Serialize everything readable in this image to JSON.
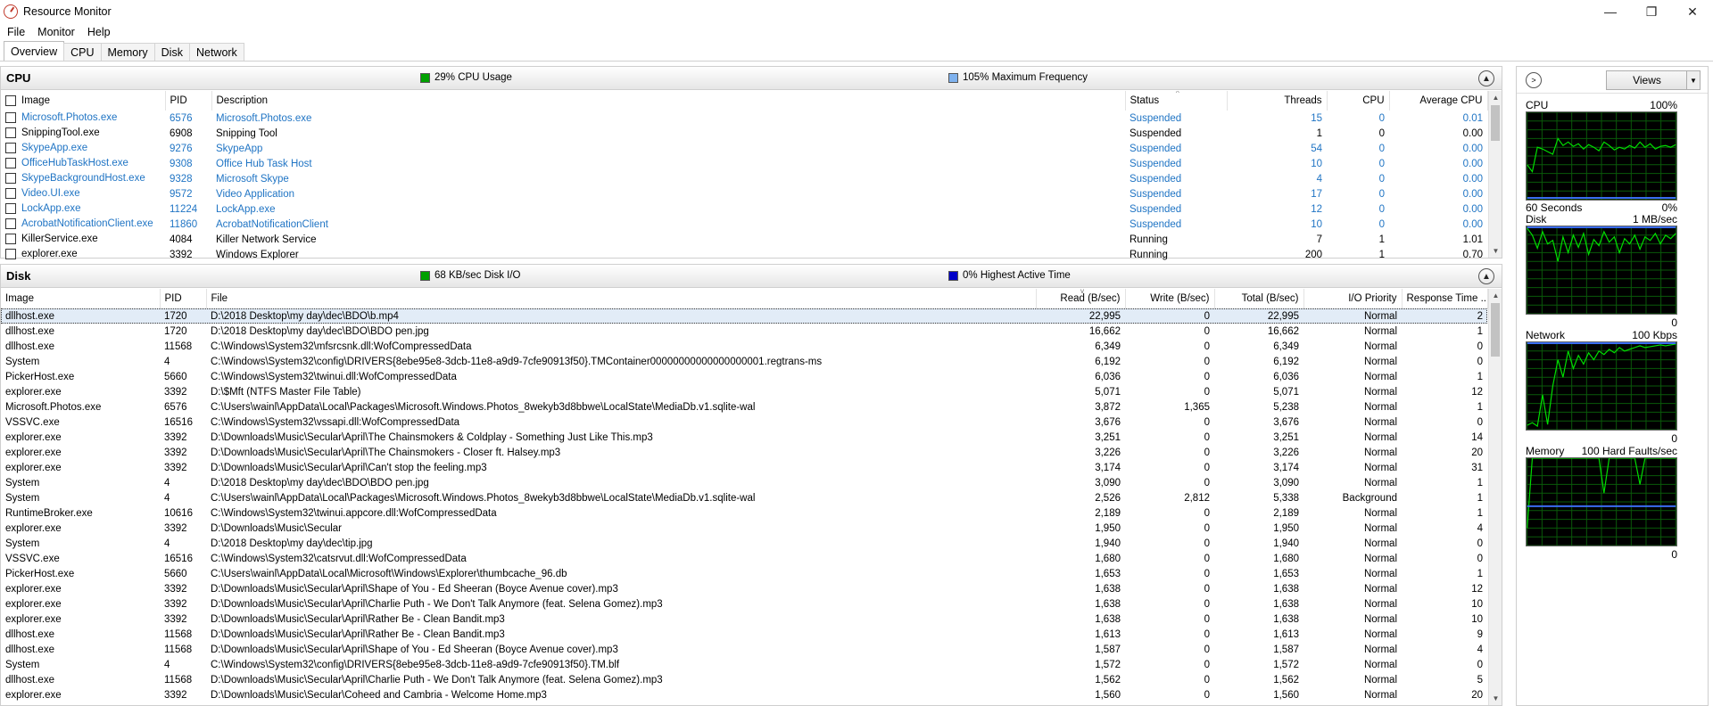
{
  "window": {
    "title": "Resource Monitor",
    "min": "—",
    "max": "❐",
    "close": "✕"
  },
  "menu": [
    {
      "label": "File"
    },
    {
      "label": "Monitor"
    },
    {
      "label": "Help"
    }
  ],
  "tabs": [
    {
      "label": "Overview",
      "active": true
    },
    {
      "label": "CPU"
    },
    {
      "label": "Memory"
    },
    {
      "label": "Disk"
    },
    {
      "label": "Network"
    }
  ],
  "cpu": {
    "title": "CPU",
    "usage_label": "29% CPU Usage",
    "usage_color": "#00a000",
    "freq_label": "105% Maximum Frequency",
    "freq_color": "#7fb2ee",
    "columns": [
      "Image",
      "PID",
      "Description",
      "Status",
      "Threads",
      "CPU",
      "Average CPU"
    ],
    "rows": [
      {
        "image": "Microsoft.Photos.exe",
        "pid": "6576",
        "desc": "Microsoft.Photos.exe",
        "status": "Suspended",
        "threads": "15",
        "cpu": "0",
        "avg": "0.01",
        "blue": true
      },
      {
        "image": "SnippingTool.exe",
        "pid": "6908",
        "desc": "Snipping Tool",
        "status": "Suspended",
        "threads": "1",
        "cpu": "0",
        "avg": "0.00",
        "blue": false
      },
      {
        "image": "SkypeApp.exe",
        "pid": "9276",
        "desc": "SkypeApp",
        "status": "Suspended",
        "threads": "54",
        "cpu": "0",
        "avg": "0.00",
        "blue": true
      },
      {
        "image": "OfficeHubTaskHost.exe",
        "pid": "9308",
        "desc": "Office Hub Task Host",
        "status": "Suspended",
        "threads": "10",
        "cpu": "0",
        "avg": "0.00",
        "blue": true
      },
      {
        "image": "SkypeBackgroundHost.exe",
        "pid": "9328",
        "desc": "Microsoft Skype",
        "status": "Suspended",
        "threads": "4",
        "cpu": "0",
        "avg": "0.00",
        "blue": true
      },
      {
        "image": "Video.UI.exe",
        "pid": "9572",
        "desc": "Video Application",
        "status": "Suspended",
        "threads": "17",
        "cpu": "0",
        "avg": "0.00",
        "blue": true
      },
      {
        "image": "LockApp.exe",
        "pid": "11224",
        "desc": "LockApp.exe",
        "status": "Suspended",
        "threads": "12",
        "cpu": "0",
        "avg": "0.00",
        "blue": true
      },
      {
        "image": "AcrobatNotificationClient.exe",
        "pid": "11860",
        "desc": "AcrobatNotificationClient",
        "status": "Suspended",
        "threads": "10",
        "cpu": "0",
        "avg": "0.00",
        "blue": true
      },
      {
        "image": "KillerService.exe",
        "pid": "4084",
        "desc": "Killer Network Service",
        "status": "Running",
        "threads": "7",
        "cpu": "1",
        "avg": "1.01",
        "blue": false
      },
      {
        "image": "explorer.exe",
        "pid": "3392",
        "desc": "Windows Explorer",
        "status": "Running",
        "threads": "200",
        "cpu": "1",
        "avg": "0.70",
        "blue": false
      }
    ]
  },
  "disk": {
    "title": "Disk",
    "io_label": "68 KB/sec Disk I/O",
    "io_color": "#00a000",
    "active_label": "0% Highest Active Time",
    "active_color": "#0000c8",
    "columns": [
      "Image",
      "PID",
      "File",
      "Read (B/sec)",
      "Write (B/sec)",
      "Total (B/sec)",
      "I/O Priority",
      "Response Time ..."
    ],
    "rows": [
      {
        "image": "dllhost.exe",
        "pid": "1720",
        "file": "D:\\2018 Desktop\\my day\\dec\\BDO\\b.mp4",
        "read": "22,995",
        "write": "0",
        "total": "22,995",
        "prio": "Normal",
        "resp": "2",
        "sel": true
      },
      {
        "image": "dllhost.exe",
        "pid": "1720",
        "file": "D:\\2018 Desktop\\my day\\dec\\BDO\\BDO pen.jpg",
        "read": "16,662",
        "write": "0",
        "total": "16,662",
        "prio": "Normal",
        "resp": "1"
      },
      {
        "image": "dllhost.exe",
        "pid": "11568",
        "file": "C:\\Windows\\System32\\mfsrcsnk.dll:WofCompressedData",
        "read": "6,349",
        "write": "0",
        "total": "6,349",
        "prio": "Normal",
        "resp": "0"
      },
      {
        "image": "System",
        "pid": "4",
        "file": "C:\\Windows\\System32\\config\\DRIVERS{8ebe95e8-3dcb-11e8-a9d9-7cfe90913f50}.TMContainer00000000000000000001.regtrans-ms",
        "read": "6,192",
        "write": "0",
        "total": "6,192",
        "prio": "Normal",
        "resp": "0"
      },
      {
        "image": "PickerHost.exe",
        "pid": "5660",
        "file": "C:\\Windows\\System32\\twinui.dll:WofCompressedData",
        "read": "6,036",
        "write": "0",
        "total": "6,036",
        "prio": "Normal",
        "resp": "1"
      },
      {
        "image": "explorer.exe",
        "pid": "3392",
        "file": "D:\\$Mft (NTFS Master File Table)",
        "read": "5,071",
        "write": "0",
        "total": "5,071",
        "prio": "Normal",
        "resp": "12"
      },
      {
        "image": "Microsoft.Photos.exe",
        "pid": "6576",
        "file": "C:\\Users\\wainl\\AppData\\Local\\Packages\\Microsoft.Windows.Photos_8wekyb3d8bbwe\\LocalState\\MediaDb.v1.sqlite-wal",
        "read": "3,872",
        "write": "1,365",
        "total": "5,238",
        "prio": "Normal",
        "resp": "1"
      },
      {
        "image": "VSSVC.exe",
        "pid": "16516",
        "file": "C:\\Windows\\System32\\vssapi.dll:WofCompressedData",
        "read": "3,676",
        "write": "0",
        "total": "3,676",
        "prio": "Normal",
        "resp": "0"
      },
      {
        "image": "explorer.exe",
        "pid": "3392",
        "file": "D:\\Downloads\\Music\\Secular\\April\\The Chainsmokers & Coldplay - Something Just Like This.mp3",
        "read": "3,251",
        "write": "0",
        "total": "3,251",
        "prio": "Normal",
        "resp": "14"
      },
      {
        "image": "explorer.exe",
        "pid": "3392",
        "file": "D:\\Downloads\\Music\\Secular\\April\\The Chainsmokers - Closer ft. Halsey.mp3",
        "read": "3,226",
        "write": "0",
        "total": "3,226",
        "prio": "Normal",
        "resp": "20"
      },
      {
        "image": "explorer.exe",
        "pid": "3392",
        "file": "D:\\Downloads\\Music\\Secular\\April\\Can't stop the feeling.mp3",
        "read": "3,174",
        "write": "0",
        "total": "3,174",
        "prio": "Normal",
        "resp": "31"
      },
      {
        "image": "System",
        "pid": "4",
        "file": "D:\\2018 Desktop\\my day\\dec\\BDO\\BDO pen.jpg",
        "read": "3,090",
        "write": "0",
        "total": "3,090",
        "prio": "Normal",
        "resp": "1"
      },
      {
        "image": "System",
        "pid": "4",
        "file": "C:\\Users\\wainl\\AppData\\Local\\Packages\\Microsoft.Windows.Photos_8wekyb3d8bbwe\\LocalState\\MediaDb.v1.sqlite-wal",
        "read": "2,526",
        "write": "2,812",
        "total": "5,338",
        "prio": "Background",
        "resp": "1"
      },
      {
        "image": "RuntimeBroker.exe",
        "pid": "10616",
        "file": "C:\\Windows\\System32\\twinui.appcore.dll:WofCompressedData",
        "read": "2,189",
        "write": "0",
        "total": "2,189",
        "prio": "Normal",
        "resp": "1"
      },
      {
        "image": "explorer.exe",
        "pid": "3392",
        "file": "D:\\Downloads\\Music\\Secular",
        "read": "1,950",
        "write": "0",
        "total": "1,950",
        "prio": "Normal",
        "resp": "4"
      },
      {
        "image": "System",
        "pid": "4",
        "file": "D:\\2018 Desktop\\my day\\dec\\tip.jpg",
        "read": "1,940",
        "write": "0",
        "total": "1,940",
        "prio": "Normal",
        "resp": "0"
      },
      {
        "image": "VSSVC.exe",
        "pid": "16516",
        "file": "C:\\Windows\\System32\\catsrvut.dll:WofCompressedData",
        "read": "1,680",
        "write": "0",
        "total": "1,680",
        "prio": "Normal",
        "resp": "0"
      },
      {
        "image": "PickerHost.exe",
        "pid": "5660",
        "file": "C:\\Users\\wainl\\AppData\\Local\\Microsoft\\Windows\\Explorer\\thumbcache_96.db",
        "read": "1,653",
        "write": "0",
        "total": "1,653",
        "prio": "Normal",
        "resp": "1"
      },
      {
        "image": "explorer.exe",
        "pid": "3392",
        "file": "D:\\Downloads\\Music\\Secular\\April\\Shape of You - Ed Sheeran (Boyce Avenue cover).mp3",
        "read": "1,638",
        "write": "0",
        "total": "1,638",
        "prio": "Normal",
        "resp": "12"
      },
      {
        "image": "explorer.exe",
        "pid": "3392",
        "file": "D:\\Downloads\\Music\\Secular\\April\\Charlie Puth - We Don't Talk Anymore (feat. Selena Gomez).mp3",
        "read": "1,638",
        "write": "0",
        "total": "1,638",
        "prio": "Normal",
        "resp": "10"
      },
      {
        "image": "explorer.exe",
        "pid": "3392",
        "file": "D:\\Downloads\\Music\\Secular\\April\\Rather Be - Clean Bandit.mp3",
        "read": "1,638",
        "write": "0",
        "total": "1,638",
        "prio": "Normal",
        "resp": "10"
      },
      {
        "image": "dllhost.exe",
        "pid": "11568",
        "file": "D:\\Downloads\\Music\\Secular\\April\\Rather Be - Clean Bandit.mp3",
        "read": "1,613",
        "write": "0",
        "total": "1,613",
        "prio": "Normal",
        "resp": "9"
      },
      {
        "image": "dllhost.exe",
        "pid": "11568",
        "file": "D:\\Downloads\\Music\\Secular\\April\\Shape of You - Ed Sheeran (Boyce Avenue cover).mp3",
        "read": "1,587",
        "write": "0",
        "total": "1,587",
        "prio": "Normal",
        "resp": "4"
      },
      {
        "image": "System",
        "pid": "4",
        "file": "C:\\Windows\\System32\\config\\DRIVERS{8ebe95e8-3dcb-11e8-a9d9-7cfe90913f50}.TM.blf",
        "read": "1,572",
        "write": "0",
        "total": "1,572",
        "prio": "Normal",
        "resp": "0"
      },
      {
        "image": "dllhost.exe",
        "pid": "11568",
        "file": "D:\\Downloads\\Music\\Secular\\April\\Charlie Puth - We Don't Talk Anymore (feat. Selena Gomez).mp3",
        "read": "1,562",
        "write": "0",
        "total": "1,562",
        "prio": "Normal",
        "resp": "5"
      },
      {
        "image": "explorer.exe",
        "pid": "3392",
        "file": "D:\\Downloads\\Music\\Secular\\Coheed and Cambria - Welcome Home.mp3",
        "read": "1,560",
        "write": "0",
        "total": "1,560",
        "prio": "Normal",
        "resp": "20"
      }
    ]
  },
  "right_panel": {
    "views_label": "Views",
    "graphs": [
      {
        "name": "CPU",
        "top_right": "100%",
        "bottom_left": "60 Seconds",
        "bottom_right": "0%",
        "green": [
          40,
          32,
          60,
          58,
          55,
          52,
          70,
          62,
          66,
          61,
          64,
          58,
          63,
          60,
          56,
          66,
          62,
          57,
          60,
          58,
          62,
          59,
          66,
          60,
          64,
          58,
          61,
          62,
          60,
          63
        ],
        "blue_level": 2
      },
      {
        "name": "Disk",
        "top_right": "1 MB/sec",
        "bottom_right": "0",
        "green": [
          98,
          90,
          75,
          94,
          80,
          84,
          60,
          88,
          70,
          90,
          76,
          92,
          68,
          85,
          78,
          94,
          82,
          88,
          70,
          86,
          80,
          90,
          74,
          88,
          84,
          92,
          80,
          90,
          86,
          92
        ],
        "blue_level": 100
      },
      {
        "name": "Network",
        "top_right": "100 Kbps",
        "bottom_right": "0",
        "green": [
          5,
          8,
          4,
          40,
          6,
          50,
          80,
          60,
          90,
          70,
          85,
          75,
          88,
          80,
          90,
          86,
          92,
          88,
          94,
          90,
          92,
          94,
          96,
          94,
          95,
          96,
          97,
          96,
          97,
          98
        ],
        "blue_level": 100
      },
      {
        "name": "Memory",
        "top_right": "100 Hard Faults/sec",
        "bottom_right": "0",
        "green": [
          20,
          100,
          100,
          100,
          100,
          100,
          100,
          100,
          100,
          100,
          100,
          100,
          100,
          100,
          100,
          60,
          100,
          100,
          100,
          100,
          100,
          100,
          70,
          100,
          100,
          100,
          100,
          100,
          100,
          100
        ],
        "blue_level": 45
      }
    ]
  }
}
